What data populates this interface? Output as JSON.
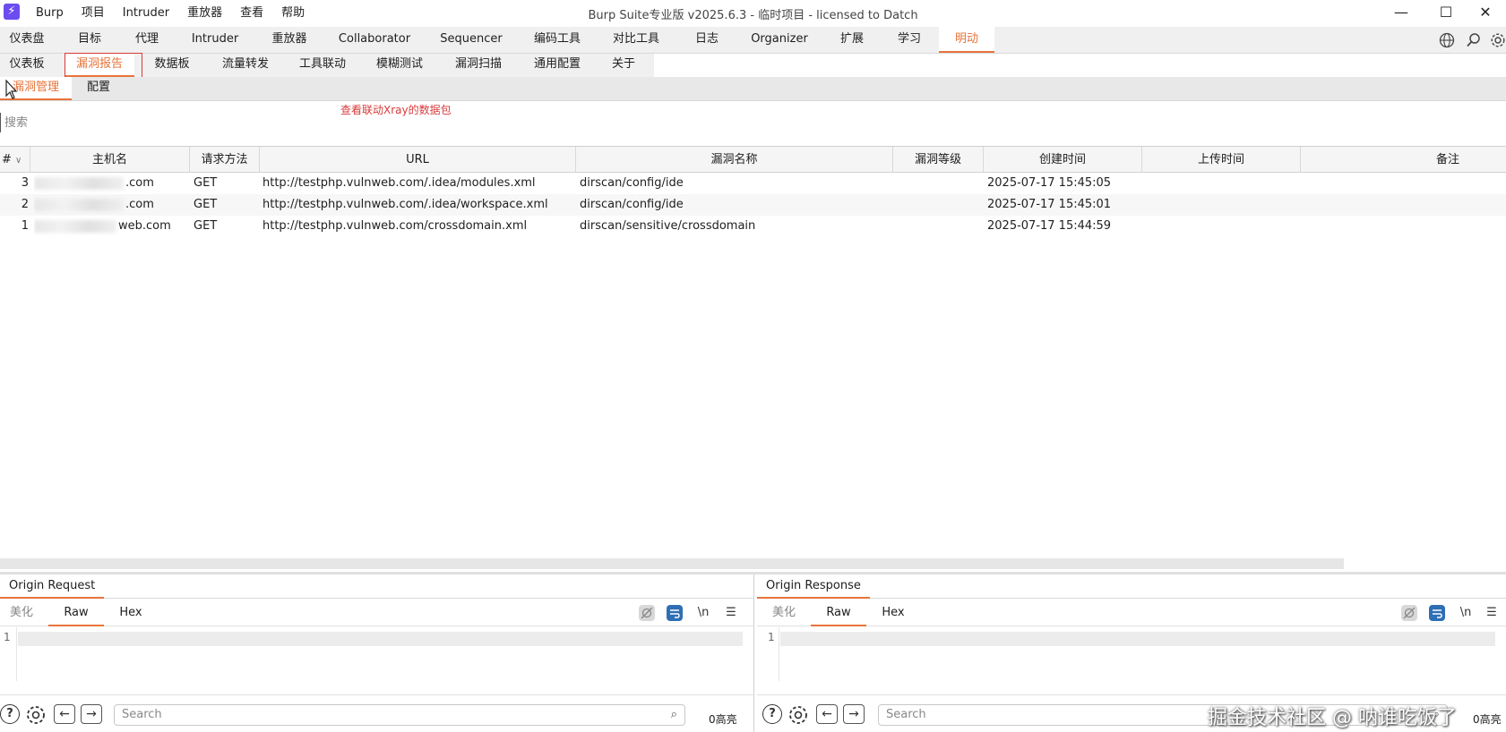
{
  "window": {
    "title": "Burp Suite专业版  v2025.6.3 - 临时项目 - licensed to Datch",
    "menu": [
      "Burp",
      "项目",
      "Intruder",
      "重放器",
      "查看",
      "帮助"
    ]
  },
  "main_tabs": [
    "仪表盘",
    "目标",
    "代理",
    "Intruder",
    "重放器",
    "Collaborator",
    "Sequencer",
    "编码工具",
    "对比工具",
    "日志",
    "Organizer",
    "扩展",
    "学习",
    "明动"
  ],
  "sub_tabs": [
    "仪表板",
    "漏洞报告",
    "数据板",
    "流量转发",
    "工具联动",
    "模糊测试",
    "漏洞扫描",
    "通用配置",
    "关于"
  ],
  "third_tabs": [
    "漏洞管理",
    "配置"
  ],
  "annotation": "查看联动Xray的数据包",
  "search": {
    "placeholder": "搜索"
  },
  "table": {
    "columns": [
      "#",
      "主机名",
      "请求方法",
      "URL",
      "漏洞名称",
      "漏洞等级",
      "创建时间",
      "上传时间",
      "备注"
    ],
    "rows": [
      {
        "id": "3",
        "host": ".com",
        "method": "GET",
        "url": "http://testphp.vulnweb.com/.idea/modules.xml",
        "vuln": "dirscan/config/ide",
        "level": "",
        "created": "2025-07-17 15:45:05",
        "uploaded": "",
        "note": ""
      },
      {
        "id": "2",
        "host": ".com",
        "method": "GET",
        "url": "http://testphp.vulnweb.com/.idea/workspace.xml",
        "vuln": "dirscan/config/ide",
        "level": "",
        "created": "2025-07-17 15:45:01",
        "uploaded": "",
        "note": ""
      },
      {
        "id": "1",
        "host": "web.com",
        "method": "GET",
        "url": "http://testphp.vulnweb.com/crossdomain.xml",
        "vuln": "dirscan/sensitive/crossdomain",
        "level": "",
        "created": "2025-07-17 15:44:59",
        "uploaded": "",
        "note": ""
      }
    ]
  },
  "request_panel": {
    "title": "Origin Request",
    "views": [
      "美化",
      "Raw",
      "Hex"
    ],
    "newline_label": "\\n",
    "line_number": "1",
    "search_placeholder": "Search",
    "highlight_count": "0高亮"
  },
  "response_panel": {
    "title": "Origin Response",
    "views": [
      "美化",
      "Raw",
      "Hex"
    ],
    "newline_label": "\\n",
    "line_number": "1",
    "search_placeholder": "Search",
    "highlight_count": "0高亮"
  },
  "watermark": "掘金技术社区 @ 呐谁吃饭了",
  "colors": {
    "accent": "#e8733a",
    "annotation_red": "#d83a3a",
    "logo": "#6c4cf0"
  }
}
